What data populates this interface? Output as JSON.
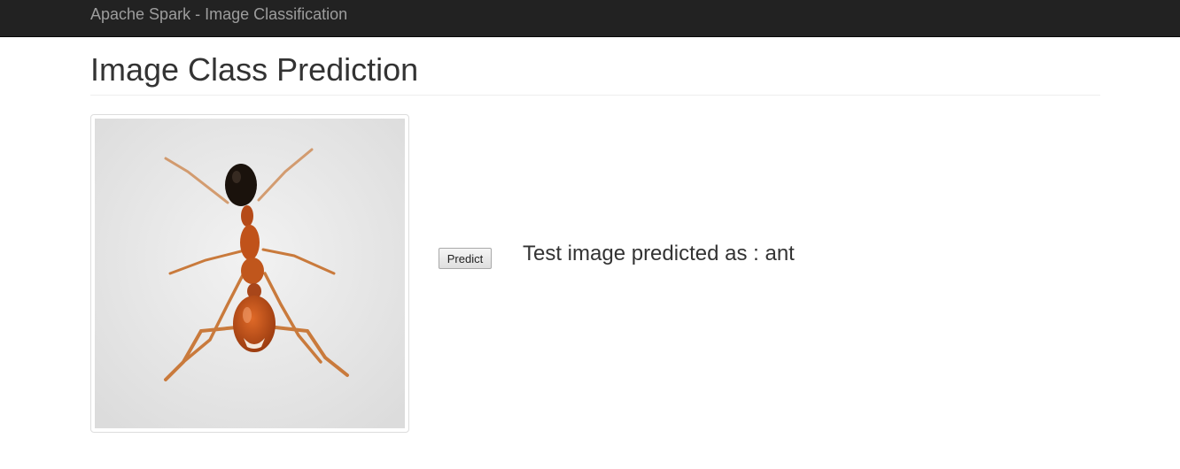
{
  "navbar": {
    "brand": "Apache Spark - Image Classification"
  },
  "page": {
    "title": "Image Class Prediction"
  },
  "image": {
    "subject": "ant",
    "colors": {
      "background": "#e8e8e8",
      "head": "#1a120c",
      "body": "#c0521a",
      "legs": "#c77a3a"
    }
  },
  "actions": {
    "predict_label": "Predict"
  },
  "result": {
    "text": "Test image predicted as : ant"
  }
}
